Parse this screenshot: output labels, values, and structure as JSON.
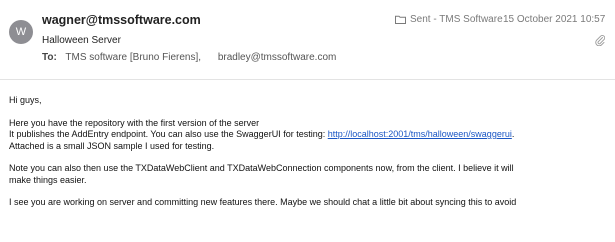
{
  "header": {
    "avatar_initial": "W",
    "sender": "wagner@tmssoftware.com",
    "subject": "Halloween Server",
    "to_label": "To:",
    "recipients": [
      "TMS software [Bruno Fierens],",
      "bradley@tmssoftware.com"
    ],
    "mailbox": "Sent - TMS Software",
    "date": "15 October 2021 10:57",
    "icons": {
      "mailbox": "folder-icon",
      "attachment": "paperclip-icon"
    }
  },
  "body": {
    "greeting": "Hi guys,",
    "p1_line1": "Here you have the repository with the first version of the server",
    "p1_line2": "It publishes the AddEntry endpoint. You can also use the SwaggerUI for testing: ",
    "p1_link": "http://localhost:2001/tms/halloween/swaggerui",
    "p1_line2_end": ".",
    "p1_line3": "Attached is a small JSON sample I used for testing.",
    "p2_line1": "Note you can also then use the TXDataWebClient and TXDataWebConnection components now, from the client. I believe it will",
    "p2_line2": "make things easier.",
    "p3_line1": "I see you are working on server and committing new features there. Maybe we should chat a little bit about syncing  this to avoid"
  },
  "colors": {
    "avatar": "#8e8e93",
    "link": "#1a56c4",
    "meta_text": "#7a7a7a"
  }
}
